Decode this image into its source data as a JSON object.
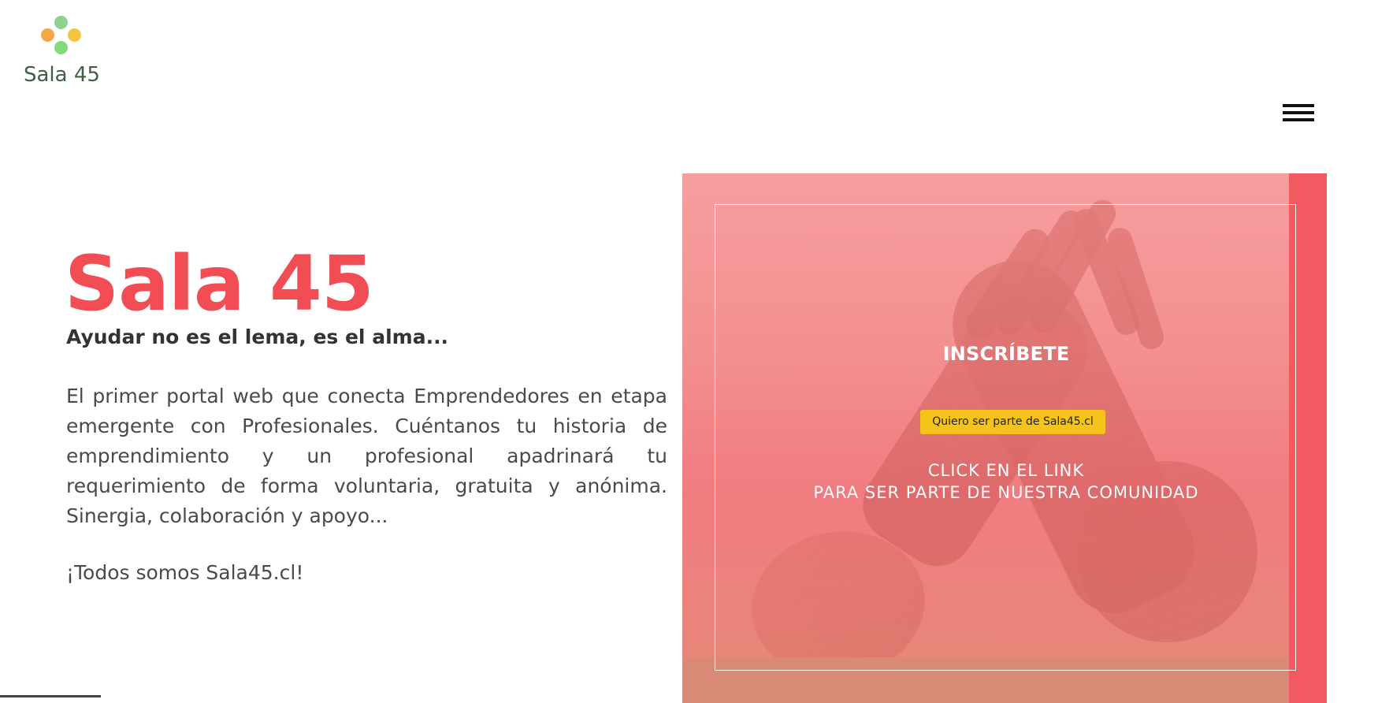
{
  "header": {
    "brand_name": "Sala 45",
    "logo_icon": "sala-45-logo-icon",
    "menu_icon": "hamburger-menu-icon"
  },
  "hero": {
    "title": "Sala 45",
    "subtitle": "Ayudar no es el lema, es el alma...",
    "body": "El primer portal web que conecta Emprendedores en etapa emergente con Profesionales. Cuéntanos tu historia de emprendimiento y un profesional apadrinará tu requerimiento de forma voluntaria, gratuita y anónima. Sinergia, colaboración y apoyo...",
    "tagline": "¡Todos somos Sala45.cl!"
  },
  "cta": {
    "title": "INSCRÍBETE",
    "button_label": "Quiero ser parte de Sala45.cl",
    "note_line_1": "CLICK EN EL LINK",
    "note_line_2": "PARA SER PARTE DE NUESTRA COMUNIDAD"
  },
  "colors": {
    "brand_red": "#f24d55",
    "cta_button_yellow": "#f6c31d",
    "logo_green": "#3f5f45"
  }
}
